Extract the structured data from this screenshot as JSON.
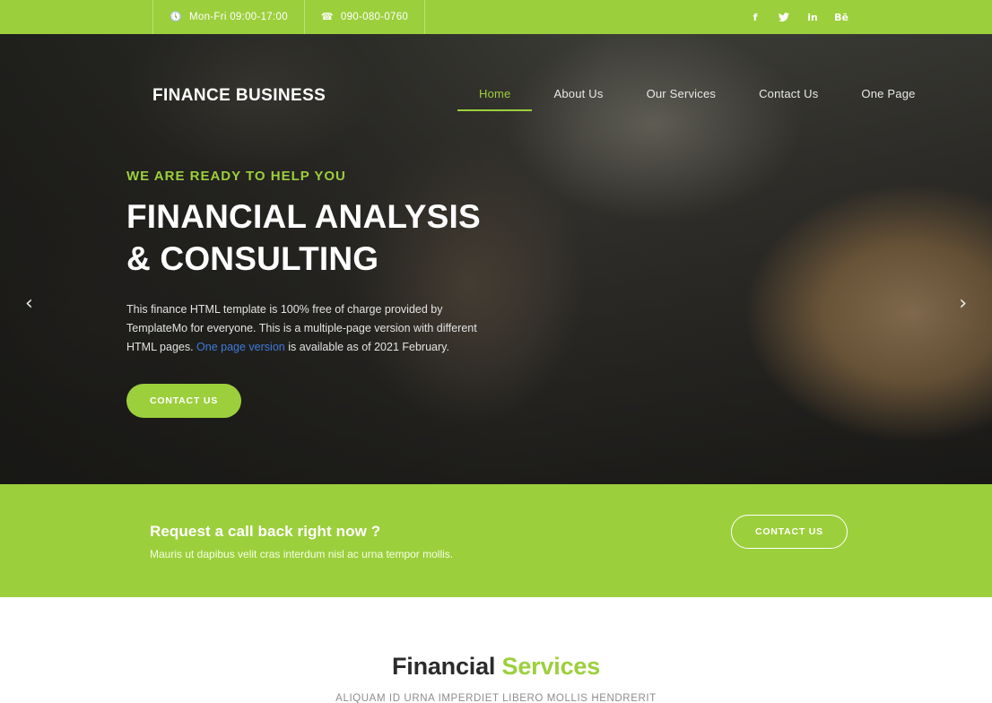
{
  "topbar": {
    "hours": "Mon-Fri 09:00-17:00",
    "hours_icon": "clock-icon",
    "phone": "090-080-0760",
    "phone_icon": "phone-icon",
    "social": [
      {
        "name": "facebook-icon",
        "glyph": "f"
      },
      {
        "name": "twitter-icon",
        "glyph": "ᴠ"
      },
      {
        "name": "linkedin-icon",
        "glyph": "in"
      },
      {
        "name": "behance-icon",
        "glyph": "Bē"
      }
    ],
    "bg_color": "#9ccf3c"
  },
  "header": {
    "logo": "FINANCE BUSINESS",
    "nav": [
      {
        "label": "Home",
        "active": true
      },
      {
        "label": "About Us",
        "active": false
      },
      {
        "label": "Our Services",
        "active": false
      },
      {
        "label": "Contact Us",
        "active": false
      },
      {
        "label": "One Page",
        "active": false
      }
    ]
  },
  "hero": {
    "kicker": "WE ARE READY TO HELP YOU",
    "headline_line1": "FINANCIAL ANALYSIS",
    "headline_line2": "& CONSULTING",
    "paragraph_part1": "This finance HTML template is 100% free of charge provided by TemplateMo for everyone. This is a multiple-page version with different HTML pages. ",
    "paragraph_link": "One page version",
    "paragraph_part2": " is available as of 2021 February.",
    "cta_label": "CONTACT US",
    "prev_arrow": "‹",
    "next_arrow": "›",
    "accent_color": "#9ccf3c",
    "link_color": "#3e7bd8"
  },
  "callback": {
    "title": "Request a call back right now ?",
    "subtitle": "Mauris ut dapibus velit cras interdum nisl ac urna tempor mollis.",
    "button_label": "CONTACT US",
    "bg_color": "#9ccf3c"
  },
  "services": {
    "title_plain": "Financial ",
    "title_accent": "Services",
    "subtitle": "ALIQUAM ID URNA IMPERDIET LIBERO MOLLIS HENDRERIT"
  }
}
